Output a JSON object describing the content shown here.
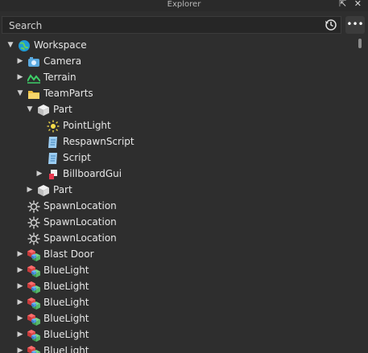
{
  "window": {
    "title": "Explorer",
    "actions": [
      "⇱",
      "✕"
    ]
  },
  "search": {
    "placeholder": "Search"
  },
  "menu": {
    "more_label": "•••"
  },
  "tree": {
    "items": [
      {
        "label": "Workspace",
        "icon": "workspace-icon",
        "level": 0,
        "arrow": "down"
      },
      {
        "label": "Camera",
        "icon": "camera-icon",
        "level": 1,
        "arrow": "right"
      },
      {
        "label": "Terrain",
        "icon": "terrain-icon",
        "level": 1,
        "arrow": "right"
      },
      {
        "label": "TeamParts",
        "icon": "folder-icon",
        "level": 1,
        "arrow": "down"
      },
      {
        "label": "Part",
        "icon": "part-icon",
        "level": 2,
        "arrow": "down"
      },
      {
        "label": "PointLight",
        "icon": "pointlight-icon",
        "level": 3,
        "arrow": "none"
      },
      {
        "label": "RespawnScript",
        "icon": "script-icon",
        "level": 3,
        "arrow": "none"
      },
      {
        "label": "Script",
        "icon": "script-icon",
        "level": 3,
        "arrow": "none"
      },
      {
        "label": "BillboardGui",
        "icon": "billboardgui-icon",
        "level": 3,
        "arrow": "right"
      },
      {
        "label": "Part",
        "icon": "part-icon",
        "level": 2,
        "arrow": "right"
      },
      {
        "label": "SpawnLocation",
        "icon": "spawnlocation-icon",
        "level": 1,
        "arrow": "none"
      },
      {
        "label": "SpawnLocation",
        "icon": "spawnlocation-icon",
        "level": 1,
        "arrow": "none"
      },
      {
        "label": "SpawnLocation",
        "icon": "spawnlocation-icon",
        "level": 1,
        "arrow": "none"
      },
      {
        "label": "Blast Door",
        "icon": "model-icon",
        "level": 1,
        "arrow": "right"
      },
      {
        "label": "BlueLight",
        "icon": "model-icon",
        "level": 1,
        "arrow": "right"
      },
      {
        "label": "BlueLight",
        "icon": "model-icon",
        "level": 1,
        "arrow": "right"
      },
      {
        "label": "BlueLight",
        "icon": "model-icon",
        "level": 1,
        "arrow": "right"
      },
      {
        "label": "BlueLight",
        "icon": "model-icon",
        "level": 1,
        "arrow": "right"
      },
      {
        "label": "BlueLight",
        "icon": "model-icon",
        "level": 1,
        "arrow": "right"
      },
      {
        "label": "BlueLight",
        "icon": "model-icon",
        "level": 1,
        "arrow": "right"
      }
    ]
  }
}
